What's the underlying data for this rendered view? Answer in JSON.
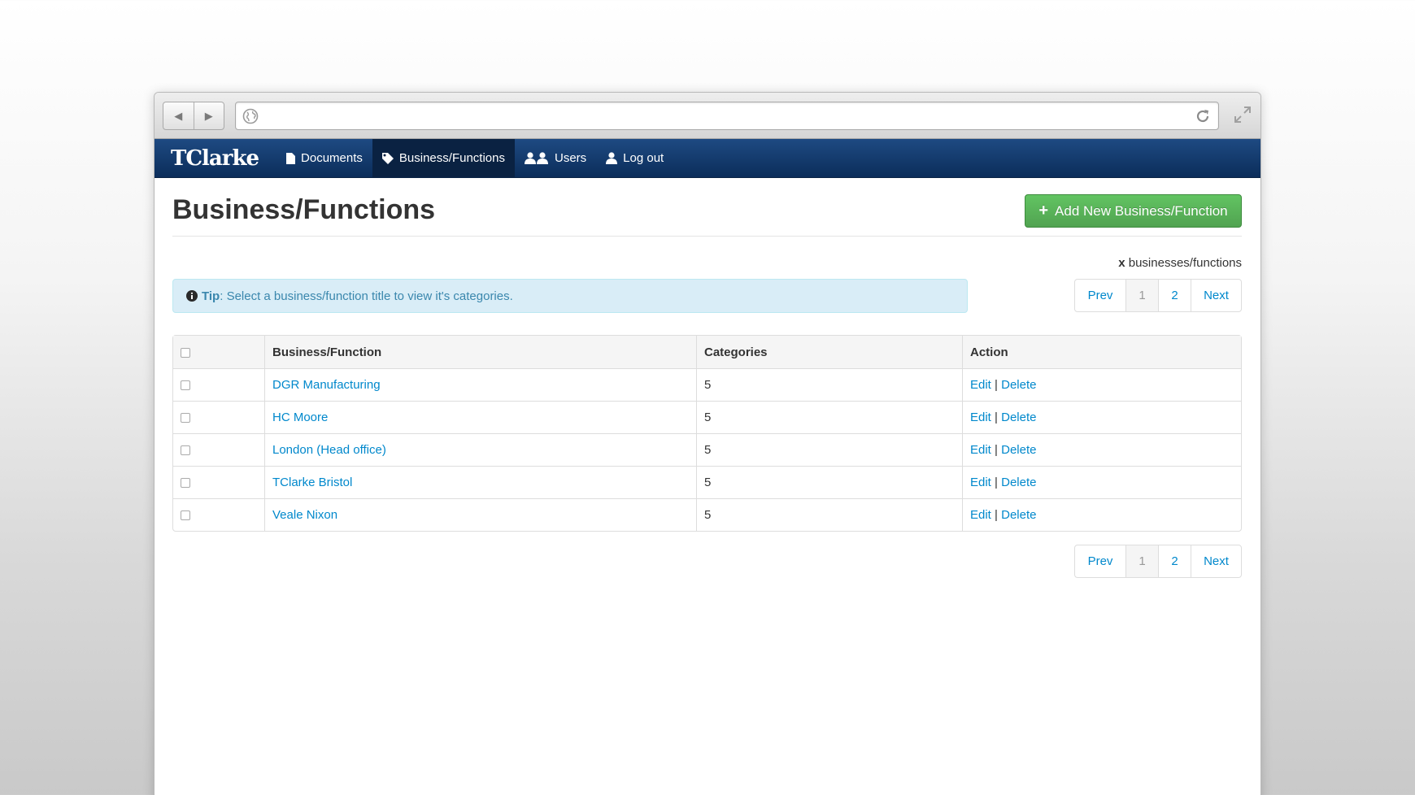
{
  "nav": {
    "brand": "TClarke",
    "items": [
      {
        "label": "Documents"
      },
      {
        "label": "Business/Functions"
      },
      {
        "label": "Users"
      },
      {
        "label": "Log out"
      }
    ]
  },
  "page": {
    "title": "Business/Functions",
    "add_button": "Add New Business/Function",
    "count_prefix": "x",
    "count_suffix": "businesses/functions",
    "tip_label": "Tip",
    "tip_text": ": Select a business/function title to view it's categories."
  },
  "pagination": {
    "prev": "Prev",
    "pages": [
      "1",
      "2"
    ],
    "current": "1",
    "next": "Next"
  },
  "table": {
    "headers": [
      "Business/Function",
      "Categories",
      "Action"
    ],
    "rows": [
      {
        "name": "DGR Manufacturing",
        "categories": "5"
      },
      {
        "name": "HC Moore",
        "categories": "5"
      },
      {
        "name": "London (Head office)",
        "categories": "5"
      },
      {
        "name": "TClarke Bristol",
        "categories": "5"
      },
      {
        "name": "Veale Nixon",
        "categories": "5"
      }
    ],
    "edit_label": "Edit",
    "separator": "|",
    "delete_label": "Delete"
  }
}
